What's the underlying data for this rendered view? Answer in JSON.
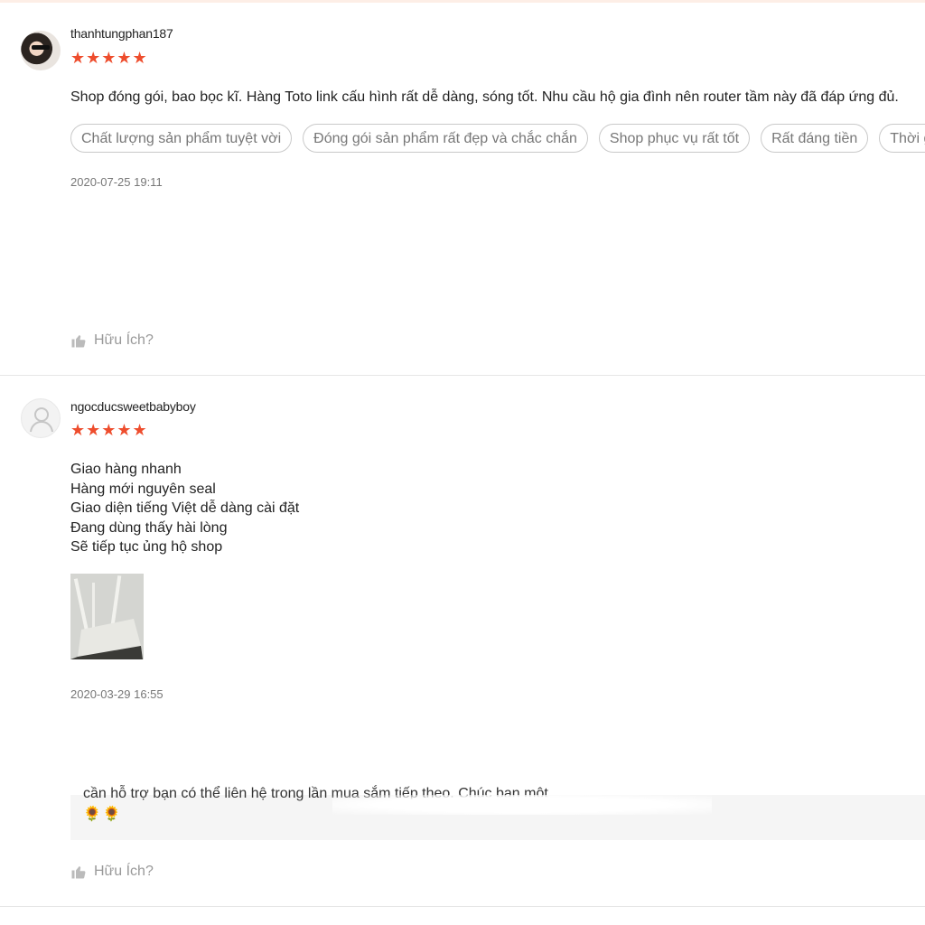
{
  "reviews": [
    {
      "username": "thanhtungphan187",
      "stars": "★★★★★",
      "content": "Shop đóng gói, bao bọc kĩ. Hàng Toto link cấu hình rất dễ dàng, sóng tốt. Nhu cầu hộ gia đình nên router tầm này đã đáp ứng đủ.",
      "tags": [
        "Chất lượng sản phẩm tuyệt vời",
        "Đóng gói sản phẩm rất đẹp và chắc chắn",
        "Shop phục vụ rất tốt",
        "Rất đáng tiền",
        "Thời gia"
      ],
      "date": "2020-07-25 19:11",
      "helpful_label": "Hữu Ích?"
    },
    {
      "username": "ngocducsweetbabyboy",
      "stars": "★★★★★",
      "content": "Giao hàng nhanh\nHàng mới nguyên seal\nGiao diện tiếng Việt dễ dàng cài đặt\nĐang dùng thấy hài lòng\nSẽ tiếp tục ủng hộ shop",
      "date": "2020-03-29 16:55",
      "seller_reply_text": "cần hỗ trợ bạn có thể liên hệ                                                                                    trong lần mua sắm tiếp theo. Chúc bạn một",
      "seller_reply_emoji": "🌻🌻",
      "helpful_label": "Hữu Ích?"
    }
  ],
  "colors": {
    "accent": "#ee4d2d",
    "muted": "#999999"
  }
}
